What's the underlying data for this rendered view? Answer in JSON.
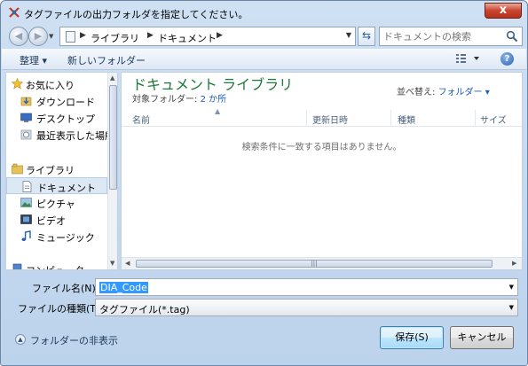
{
  "window": {
    "title": "タグファイルの出力フォルダを指定してください。",
    "close_glyph": "x"
  },
  "address": {
    "breadcrumbs": [
      "ライブラリ",
      "ドキュメント"
    ],
    "search_placeholder": "ドキュメントの検索"
  },
  "commands": {
    "organize": "整理 ▾",
    "new_folder": "新しいフォルダー",
    "help": "?"
  },
  "nav": {
    "items": [
      {
        "label": "お気に入り",
        "icon": "star-icon"
      },
      {
        "label": "ダウンロード",
        "icon": "download-folder-icon"
      },
      {
        "label": "デスクトップ",
        "icon": "desktop-icon"
      },
      {
        "label": "最近表示した場所",
        "icon": "recent-places-icon"
      },
      {
        "label": "ライブラリ",
        "icon": "library-icon"
      },
      {
        "label": "ドキュメント",
        "icon": "document-icon"
      },
      {
        "label": "ピクチャ",
        "icon": "picture-icon"
      },
      {
        "label": "ビデオ",
        "icon": "video-icon"
      },
      {
        "label": "ミュージック",
        "icon": "music-icon"
      },
      {
        "label": "コンピューター",
        "icon": "computer-icon"
      }
    ]
  },
  "content": {
    "library_title": "ドキュメント ライブラリ",
    "target_label": "対象フォルダー:",
    "target_value": "2 か所",
    "arrange_label": "並べ替え:",
    "arrange_value": "フォルダー ▾",
    "columns": [
      "名前",
      "更新日時",
      "種類",
      "サイズ"
    ],
    "empty_message": "検索条件に一致する項目はありません。"
  },
  "filename": {
    "label": "ファイル名(N):",
    "value": "DIA_Code"
  },
  "filetype": {
    "label": "ファイルの種類(T):",
    "value": "タグファイル(*.tag)"
  },
  "footer": {
    "hide_folders": "フォルダーの非表示",
    "save": "保存(S)",
    "cancel": "キャンセル"
  },
  "colors": {
    "accent": "#1e7a3a",
    "link": "#1d5db4",
    "selection": "#3399ff"
  }
}
